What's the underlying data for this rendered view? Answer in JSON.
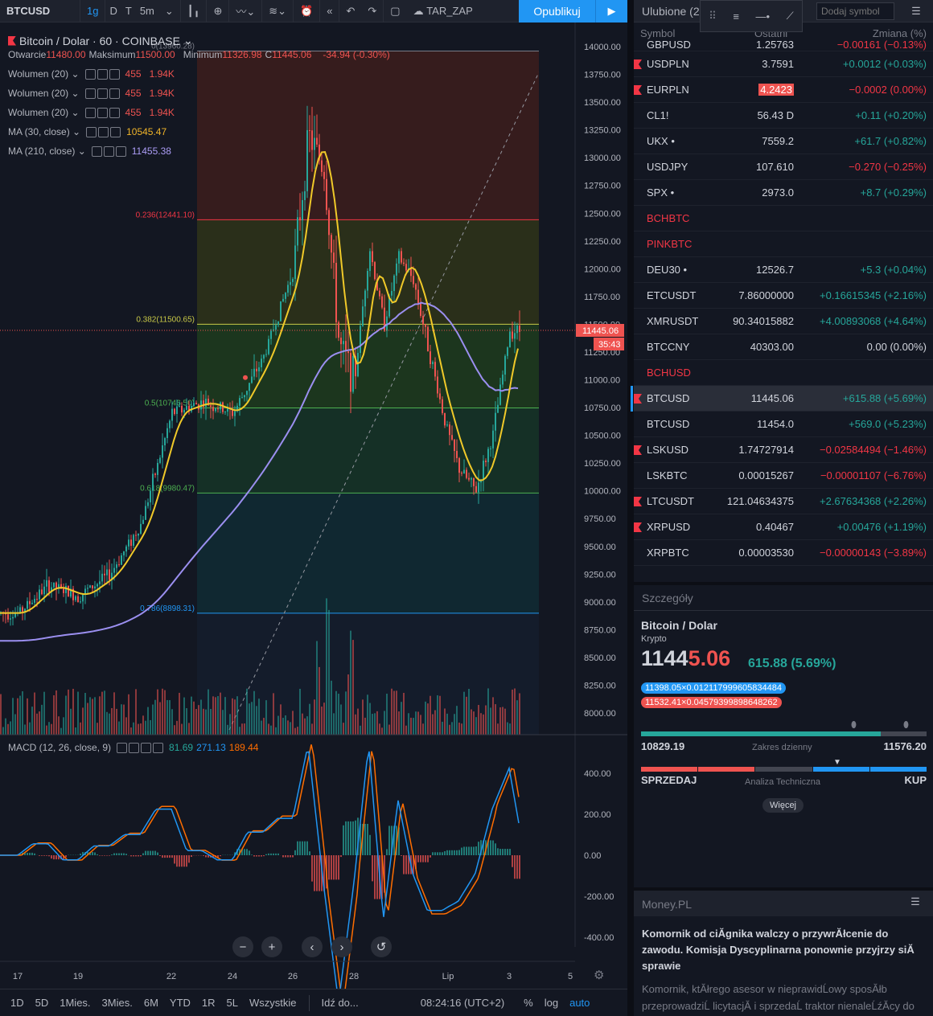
{
  "toolbar": {
    "symbol": "BTCUSD",
    "intervals": [
      "1g",
      "D",
      "T",
      "5m"
    ],
    "template": "TAR_ZAP",
    "publish": "Opublikuj"
  },
  "legend": {
    "title": "Bitcoin / Dolar · 60 · COINBASE",
    "ohlc": {
      "o_label": "Otwarcie",
      "o": "11480.00",
      "h_label": "Maksimum",
      "h": "11500.00",
      "l_label": "Minimum",
      "l": "11326.98",
      "c_label": "C",
      "c": "11445.06",
      "chg": "-34.94 (-0.30%)"
    },
    "indicators": [
      {
        "name": "Wolumen (20)",
        "v1": "455",
        "v2": "1.94K"
      },
      {
        "name": "Wolumen (20)",
        "v1": "455",
        "v2": "1.94K"
      },
      {
        "name": "Wolumen (20)",
        "v1": "455",
        "v2": "1.94K"
      },
      {
        "name": "MA (30, close)",
        "v1": "10545.47"
      },
      {
        "name": "MA (210, close)",
        "v1": "11455.38"
      }
    ],
    "macd": {
      "name": "MACD (12, 26, close, 9)",
      "v1": "81.69",
      "v2": "271.13",
      "v3": "189.44"
    }
  },
  "chart_data": {
    "type": "candlestick",
    "price_axis": [
      "14000.00",
      "13750.00",
      "13500.00",
      "13250.00",
      "13000.00",
      "12750.00",
      "12500.00",
      "12250.00",
      "12000.00",
      "11750.00",
      "11500.00",
      "11250.00",
      "11000.00",
      "10750.00",
      "10500.00",
      "10250.00",
      "10000.00",
      "9750.00",
      "9500.00",
      "9250.00",
      "9000.00",
      "8750.00",
      "8500.00",
      "8250.00",
      "8000.00"
    ],
    "ylim": [
      7800,
      14000
    ],
    "last_price": "11445.06",
    "countdown": "35:43",
    "fib": [
      {
        "label": "0(13960.28)",
        "price": 13960.28
      },
      {
        "label": "0.236(12441.10)",
        "price": 12441.1
      },
      {
        "label": "0.382(11500.65)",
        "price": 11500.65
      },
      {
        "label": "0.5(10746.50)",
        "price": 10746.5
      },
      {
        "label": "0.618(9980.47)",
        "price": 9980.47
      },
      {
        "label": "0.786(8898.31)",
        "price": 8898.31
      }
    ],
    "price_path": [
      [
        17,
        8900
      ],
      [
        18,
        9150
      ],
      [
        19,
        9050
      ],
      [
        20,
        9250
      ],
      [
        21,
        9700
      ],
      [
        22,
        10700
      ],
      [
        23,
        10800
      ],
      [
        24,
        10700
      ],
      [
        25,
        11200
      ],
      [
        26,
        12000
      ],
      [
        26.5,
        13200
      ],
      [
        27,
        12900
      ],
      [
        27.5,
        11300
      ],
      [
        28,
        11000
      ],
      [
        28.5,
        12200
      ],
      [
        29,
        11500
      ],
      [
        29.5,
        12100
      ],
      [
        30,
        11900
      ],
      [
        30.5,
        11300
      ],
      [
        31,
        10700
      ],
      [
        31.5,
        10200
      ],
      [
        32,
        10000
      ],
      [
        32.5,
        10500
      ],
      [
        33,
        11445
      ]
    ],
    "macd_axis": [
      "400.00",
      "200.00",
      "0.00",
      "-200.00",
      "-400.00"
    ],
    "x_labels": [
      "17",
      "19",
      "22",
      "24",
      "26",
      "28",
      "Lip",
      "3",
      "5"
    ]
  },
  "bottom": {
    "ranges": [
      "1D",
      "5D",
      "1Mies.",
      "3Mies.",
      "6M",
      "YTD",
      "1R",
      "5L",
      "Wszystkie"
    ],
    "goto": "Idź do...",
    "time": "08:24:16 (UTC+2)",
    "pct": "%",
    "log": "log",
    "auto": "auto"
  },
  "watchlist": {
    "title": "Ulubione (2",
    "add_placeholder": "Dodaj symbol",
    "col_symbol": "Symbol",
    "col_last": "Ostatni",
    "col_change": "Zmiana (%)",
    "rows": [
      {
        "sym": "GBPUSD",
        "last": "1.25763",
        "chg": "−0.00161 (−0.13%)",
        "dir": "neg",
        "flag": false,
        "head": true
      },
      {
        "sym": "USDPLN",
        "last": "3.7591",
        "chg": "+0.0012 (+0.03%)",
        "dir": "pos",
        "flag": true
      },
      {
        "sym": "EURPLN",
        "last": "4.2423",
        "chg": "−0.0002 (0.00%)",
        "dir": "neg",
        "flag": true,
        "hl": true
      },
      {
        "sym": "CL1!",
        "last": "56.43 D",
        "chg": "+0.11 (+0.20%)",
        "dir": "pos",
        "flag": false
      },
      {
        "sym": "UKX •",
        "last": "7559.2",
        "chg": "+61.7 (+0.82%)",
        "dir": "pos",
        "flag": false
      },
      {
        "sym": "USDJPY",
        "last": "107.610",
        "chg": "−0.270 (−0.25%)",
        "dir": "neg",
        "flag": false
      },
      {
        "sym": "SPX •",
        "last": "2973.0",
        "chg": "+8.7 (+0.29%)",
        "dir": "pos",
        "flag": false
      },
      {
        "sym": "BCHBTC",
        "section": true
      },
      {
        "sym": "PINKBTC",
        "section": true
      },
      {
        "sym": "DEU30 •",
        "last": "12526.7",
        "chg": "+5.3 (+0.04%)",
        "dir": "pos",
        "flag": false
      },
      {
        "sym": "ETCUSDT",
        "last": "7.86000000",
        "chg": "+0.16615345 (+2.16%)",
        "dir": "pos",
        "flag": false
      },
      {
        "sym": "XMRUSDT",
        "last": "90.34015882",
        "chg": "+4.00893068 (+4.64%)",
        "dir": "pos",
        "flag": false
      },
      {
        "sym": "BTCCNY",
        "last": "40303.00",
        "chg": "0.00 (0.00%)",
        "dir": "neu",
        "flag": false
      },
      {
        "sym": "BCHUSD",
        "section": true
      },
      {
        "sym": "BTCUSD",
        "last": "11445.06",
        "chg": "+615.88 (+5.69%)",
        "dir": "pos",
        "flag": true,
        "sel": true
      },
      {
        "sym": "BTCUSD",
        "last": "11454.0",
        "chg": "+569.0 (+5.23%)",
        "dir": "pos",
        "flag": false
      },
      {
        "sym": "LSKUSD",
        "last": "1.74727914",
        "chg": "−0.02584494 (−1.46%)",
        "dir": "neg",
        "flag": true
      },
      {
        "sym": "LSKBTC",
        "last": "0.00015267",
        "chg": "−0.00001107 (−6.76%)",
        "dir": "neg",
        "flag": false
      },
      {
        "sym": "LTCUSDT",
        "last": "121.04634375",
        "chg": "+2.67634368 (+2.26%)",
        "dir": "pos",
        "flag": true
      },
      {
        "sym": "XRPUSD",
        "last": "0.40467",
        "chg": "+0.00476 (+1.19%)",
        "dir": "pos",
        "flag": true
      },
      {
        "sym": "XRPBTC",
        "last": "0.00003530",
        "chg": "−0.00000143 (−3.89%)",
        "dir": "neg",
        "flag": false
      }
    ]
  },
  "details": {
    "header": "Szczegóły",
    "name": "Bitcoin / Dolar",
    "type": "Krypto",
    "price_a": "1144",
    "price_b": "5.06",
    "change": "615.88 (5.69%)",
    "bid": "11398.05×0.012117999605834484",
    "ask": "11532.41×0.04579399898648262",
    "low": "10829.19",
    "range_label": "Zakres dzienny",
    "high": "11576.20",
    "range_fill": 0.84,
    "sell": "SPRZEDAJ",
    "ta_label": "Analiza Techniczna",
    "buy": "KUP",
    "more": "Więcej"
  },
  "news": {
    "source": "Money.PL",
    "headline": "Komornik od ciĂgnika walczy o przywrĂłcenie do zawodu. Komisja Dyscyplinarna ponownie przyjrzy siĂ sprawie",
    "body": "Komornik, ktĂłrego asesor w nieprawidĹowy sposĂłb przeprowadziĹ licytacjĂ i sprzedaĹ traktor nienaleĹźĂcy do"
  }
}
